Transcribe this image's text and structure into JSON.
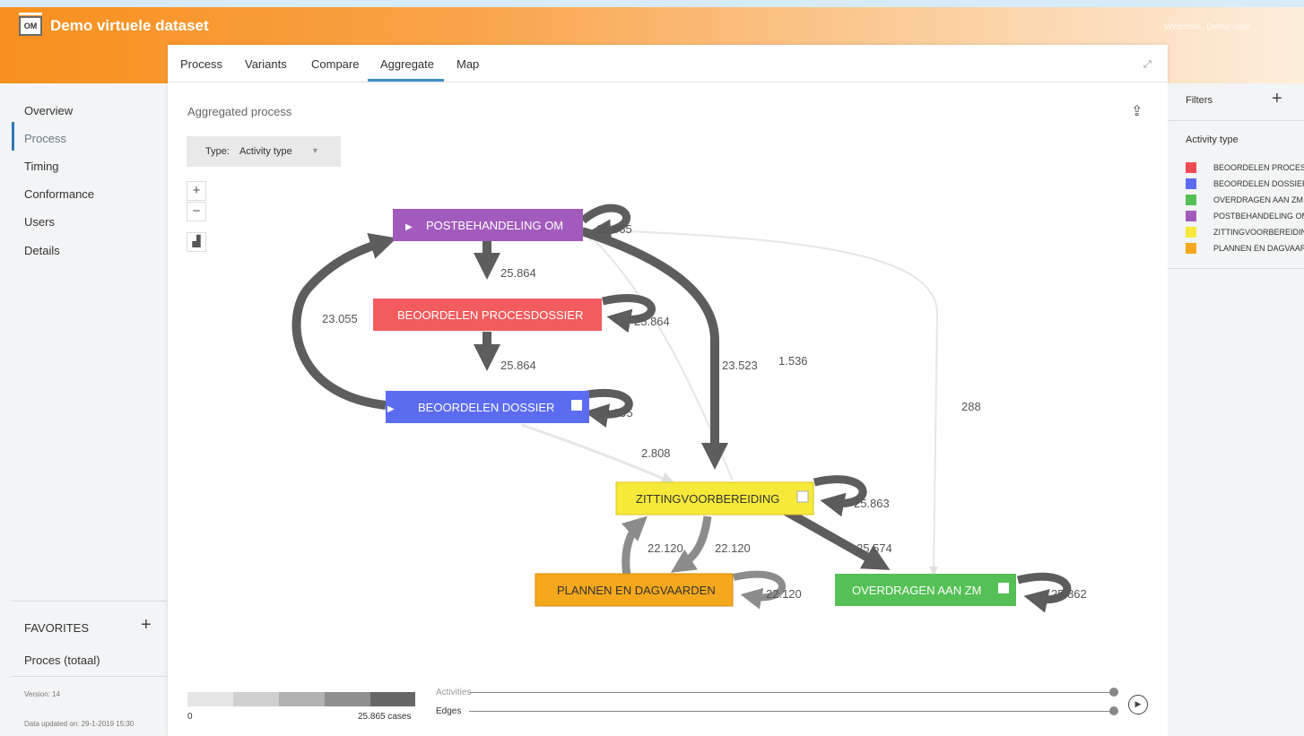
{
  "app": {
    "title": "Demo virtuele dataset",
    "logo_text": "OM",
    "user_text": "Welcome, Demo user"
  },
  "sidebar": {
    "items": [
      {
        "label": "Overview"
      },
      {
        "label": "Process",
        "active": true
      },
      {
        "label": "Timing"
      },
      {
        "label": "Conformance"
      },
      {
        "label": "Users"
      },
      {
        "label": "Details"
      }
    ],
    "favorites_title": "FAVORITES",
    "favorites_add": "+",
    "favorites_items": [
      "Proces (totaal)"
    ],
    "version": "Version: 14",
    "updated": "Data updated on: 29-1-2019 15:30"
  },
  "tabs": [
    {
      "label": "Process"
    },
    {
      "label": "Variants"
    },
    {
      "label": "Compare"
    },
    {
      "label": "Aggregate",
      "active": true
    },
    {
      "label": "Map"
    }
  ],
  "main": {
    "title": "Aggregated process",
    "type_label": "Type:",
    "type_value": "Activity type",
    "zoom_in": "+",
    "zoom_out": "−"
  },
  "graph": {
    "nodes": [
      {
        "id": "post",
        "label": "POSTBEHANDELING OM",
        "color": "#a25bbd",
        "start": true,
        "end": false
      },
      {
        "id": "beop",
        "label": "BEOORDELEN PROCESDOSSIER",
        "color": "#f25c5f",
        "start": false,
        "end": false
      },
      {
        "id": "beod",
        "label": "BEOORDELEN DOSSIER",
        "color": "#5b6cf0",
        "start": true,
        "end": true
      },
      {
        "id": "zitt",
        "label": "ZITTINGVOORBEREIDING",
        "color": "#f6e93a",
        "start": false,
        "end": true
      },
      {
        "id": "plan",
        "label": "PLANNEN EN DAGVAARDEN",
        "color": "#f6a81c",
        "start": false,
        "end": false
      },
      {
        "id": "over",
        "label": "OVERDRAGEN AAN ZM",
        "color": "#55c055",
        "start": false,
        "end": true
      }
    ],
    "edge_labels": [
      "25.865",
      "25.864",
      "25.864",
      "25.864",
      "24.895",
      "23.055",
      "23.523",
      "1.536",
      "288",
      "2.808",
      "25.863",
      "22.120",
      "22.120",
      "25.574",
      "22.120",
      "25.862"
    ]
  },
  "legend_scale": {
    "min": "0",
    "max": "25.865 cases",
    "colors": [
      "#e6e6e6",
      "#cfcfcf",
      "#b2b2b2",
      "#8f8f8f",
      "#666666"
    ]
  },
  "sliders": {
    "activities_label": "Activities",
    "edges_label": "Edges"
  },
  "filters": {
    "title": "Filters",
    "add": "+",
    "section_title": "Activity type",
    "legend": [
      {
        "color": "#f04b55",
        "label": "BEOORDELEN PROCESDOSSIER"
      },
      {
        "color": "#5b6cf0",
        "label": "BEOORDELEN DOSSIER"
      },
      {
        "color": "#55c055",
        "label": "OVERDRAGEN AAN ZM"
      },
      {
        "color": "#a25bbd",
        "label": "POSTBEHANDELING OM"
      },
      {
        "color": "#f6e93a",
        "label": "ZITTINGVOORBEREIDING"
      },
      {
        "color": "#f6a81c",
        "label": "PLANNEN EN DAGVAARDEN"
      }
    ]
  }
}
